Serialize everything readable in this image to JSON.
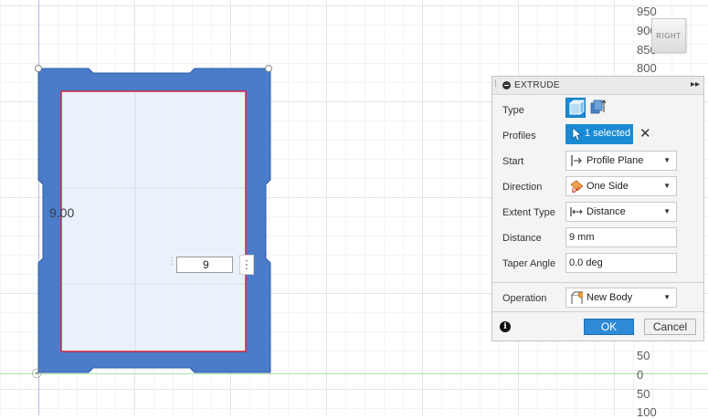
{
  "viewport": {
    "ruler_top": [
      "950",
      "900",
      "850",
      "800"
    ],
    "ruler_bottom": [
      "50",
      "0",
      "50",
      "100"
    ],
    "viewcube_label": "RIGHT",
    "dimension_label": "9.00",
    "distance_input_value": "9",
    "input_more_glyph": "⋮"
  },
  "dialog": {
    "title": "EXTRUDE",
    "type": {
      "label": "Type"
    },
    "profiles": {
      "label": "Profiles",
      "selection": "1 selected",
      "clear_glyph": "✕"
    },
    "start": {
      "label": "Start",
      "value": "Profile Plane"
    },
    "direction": {
      "label": "Direction",
      "value": "One Side"
    },
    "extent_type": {
      "label": "Extent Type",
      "value": "Distance"
    },
    "distance": {
      "label": "Distance",
      "value": "9 mm"
    },
    "taper_angle": {
      "label": "Taper Angle",
      "value": "0.0 deg"
    },
    "operation": {
      "label": "Operation",
      "value": "New Body"
    },
    "ok_label": "OK",
    "cancel_label": "Cancel",
    "info_glyph": "i"
  },
  "colors": {
    "body_fill": "#4a7cc9",
    "body_edge": "#2f5ea9",
    "profile_fill": "#e9f2fb",
    "profile_edge": "#d4243a",
    "accent": "#1a8ad4"
  }
}
